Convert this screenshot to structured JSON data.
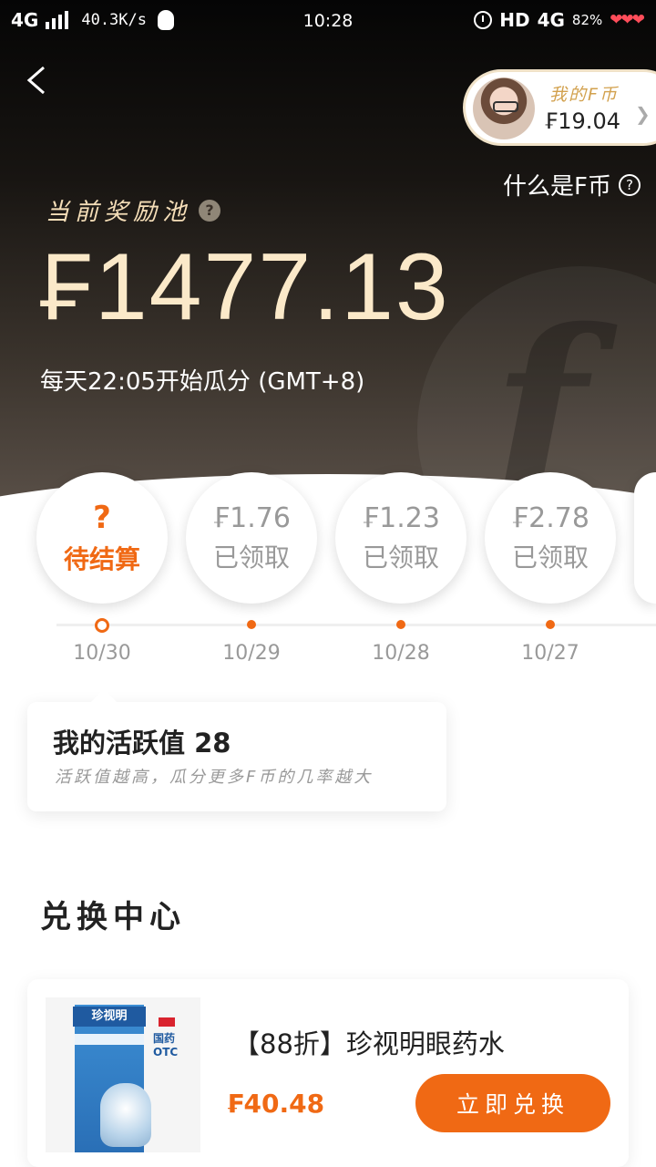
{
  "status_bar": {
    "network": "4G",
    "speed": "40.3K/s",
    "time": "10:28",
    "hd": "HD",
    "network_right": "4G",
    "battery": "82%",
    "hearts": "❤❤❤"
  },
  "header": {
    "back_icon": "chevron-left-icon",
    "coin_title": "我的F币",
    "coin_value": "₣19.04",
    "what_is": "什么是F币",
    "what_is_icon": "question-circle-icon"
  },
  "pool": {
    "label": "当前奖励池",
    "help_icon": "?",
    "amount": "₣1477.13",
    "schedule": "每天22:05开始瓜分 (GMT+8)"
  },
  "days": [
    {
      "amount": "?",
      "status": "待结算",
      "date": "10/30",
      "pending": true
    },
    {
      "amount": "₣1.76",
      "status": "已领取",
      "date": "10/29",
      "pending": false
    },
    {
      "amount": "₣1.23",
      "status": "已领取",
      "date": "10/28",
      "pending": false
    },
    {
      "amount": "₣2.78",
      "status": "已领取",
      "date": "10/27",
      "pending": false
    }
  ],
  "activity": {
    "title": "我的活跃值 28",
    "subtitle": "活跃值越高，瓜分更多F币的几率越大"
  },
  "exchange": {
    "section_title": "兑换中心",
    "product": {
      "name": "【88折】珍视明眼药水",
      "price": "₣40.48",
      "button": "立即兑换",
      "image_brand": "珍视明",
      "image_otc": "国药 OTC"
    }
  },
  "colors": {
    "accent": "#f06914",
    "gold_text": "#fbe9c9"
  }
}
